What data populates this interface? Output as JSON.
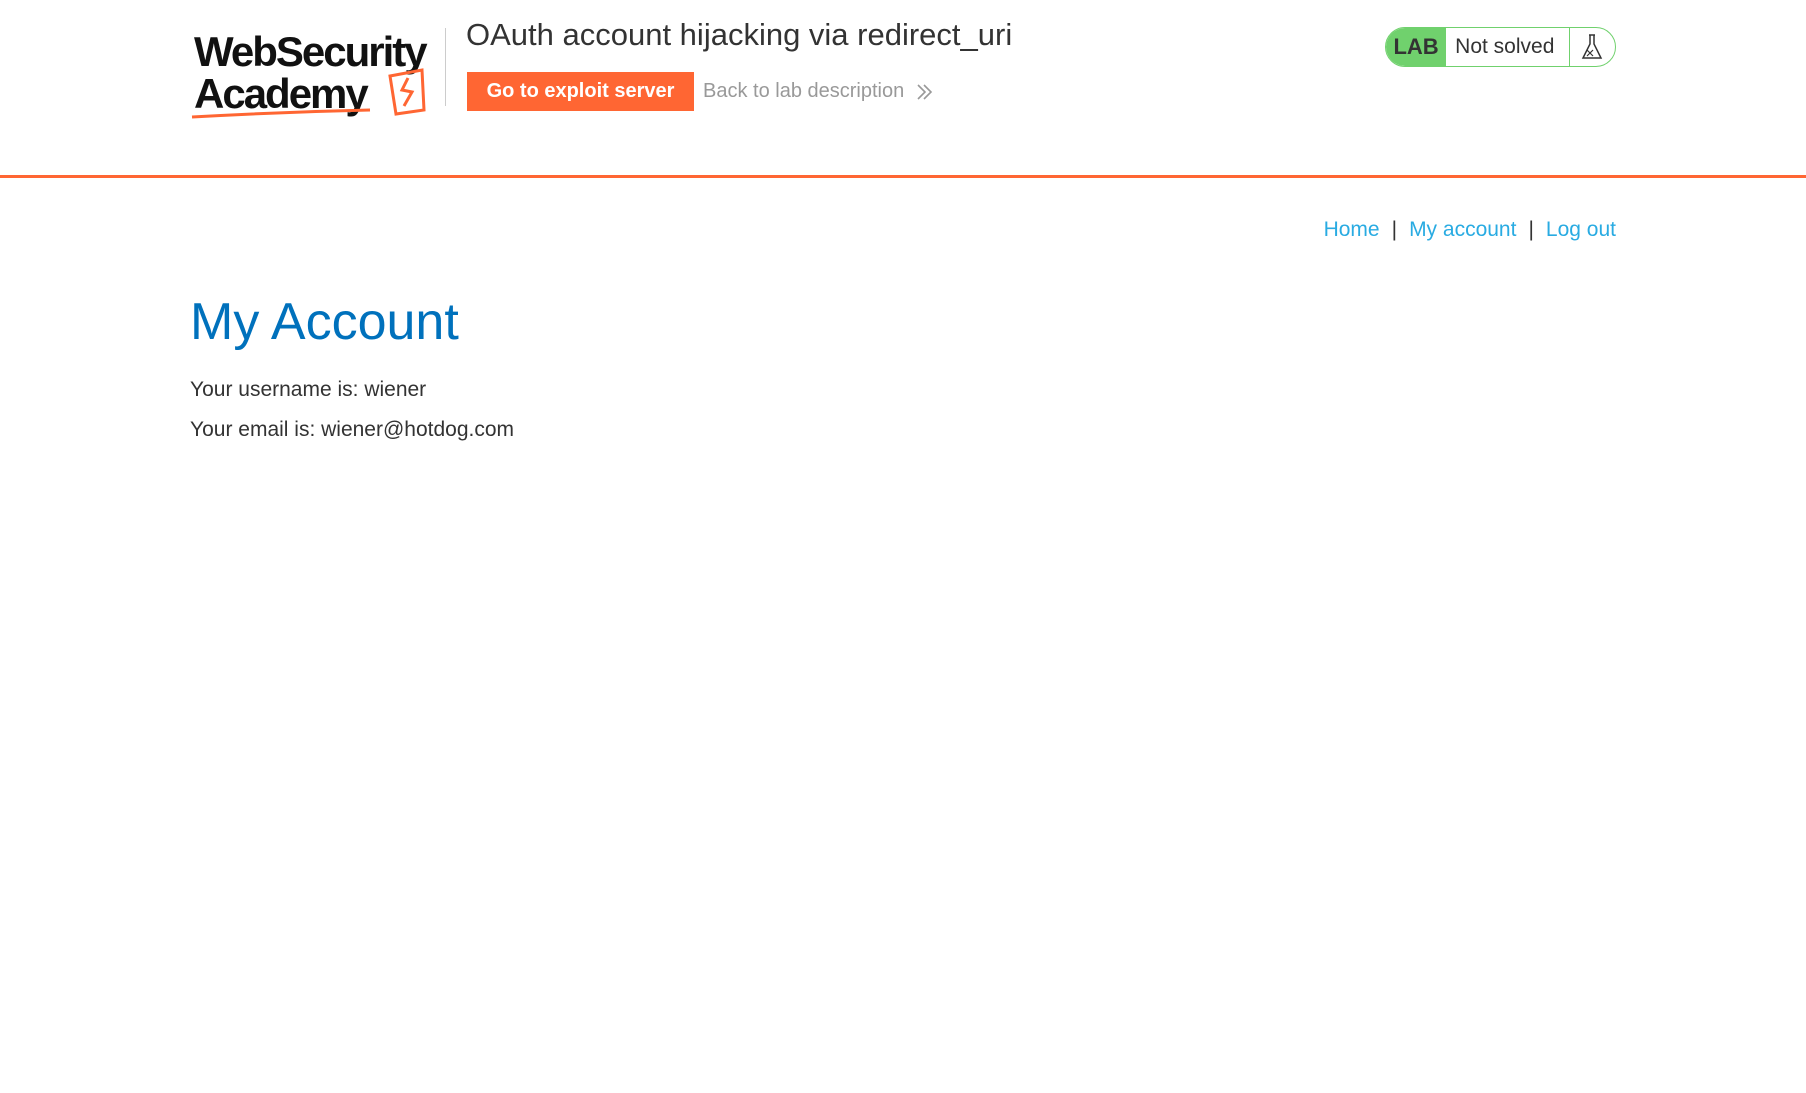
{
  "header": {
    "logo_alt": "Web Security Academy",
    "logo_line1": "WebSecurity",
    "logo_line2": "Academy",
    "lab_title": "OAuth account hijacking via redirect_uri",
    "exploit_button": "Go to exploit server",
    "back_link": "Back to lab description",
    "status_tag": "LAB",
    "status_text": "Not solved",
    "accent_color": "#ff6633",
    "status_color": "#70d16d"
  },
  "nav": {
    "home": "Home",
    "separator": "|",
    "my_account": "My account",
    "log_out": "Log out",
    "link_color": "#29abe2"
  },
  "main": {
    "title": "My Account",
    "title_color": "#0071bc",
    "username_line": "Your username is: wiener",
    "email_line": "Your email is: wiener@hotdog.com"
  },
  "icons": {
    "logo": "web-security-academy-logo",
    "back": "double-chevron-right-icon",
    "flask": "flask-icon"
  }
}
